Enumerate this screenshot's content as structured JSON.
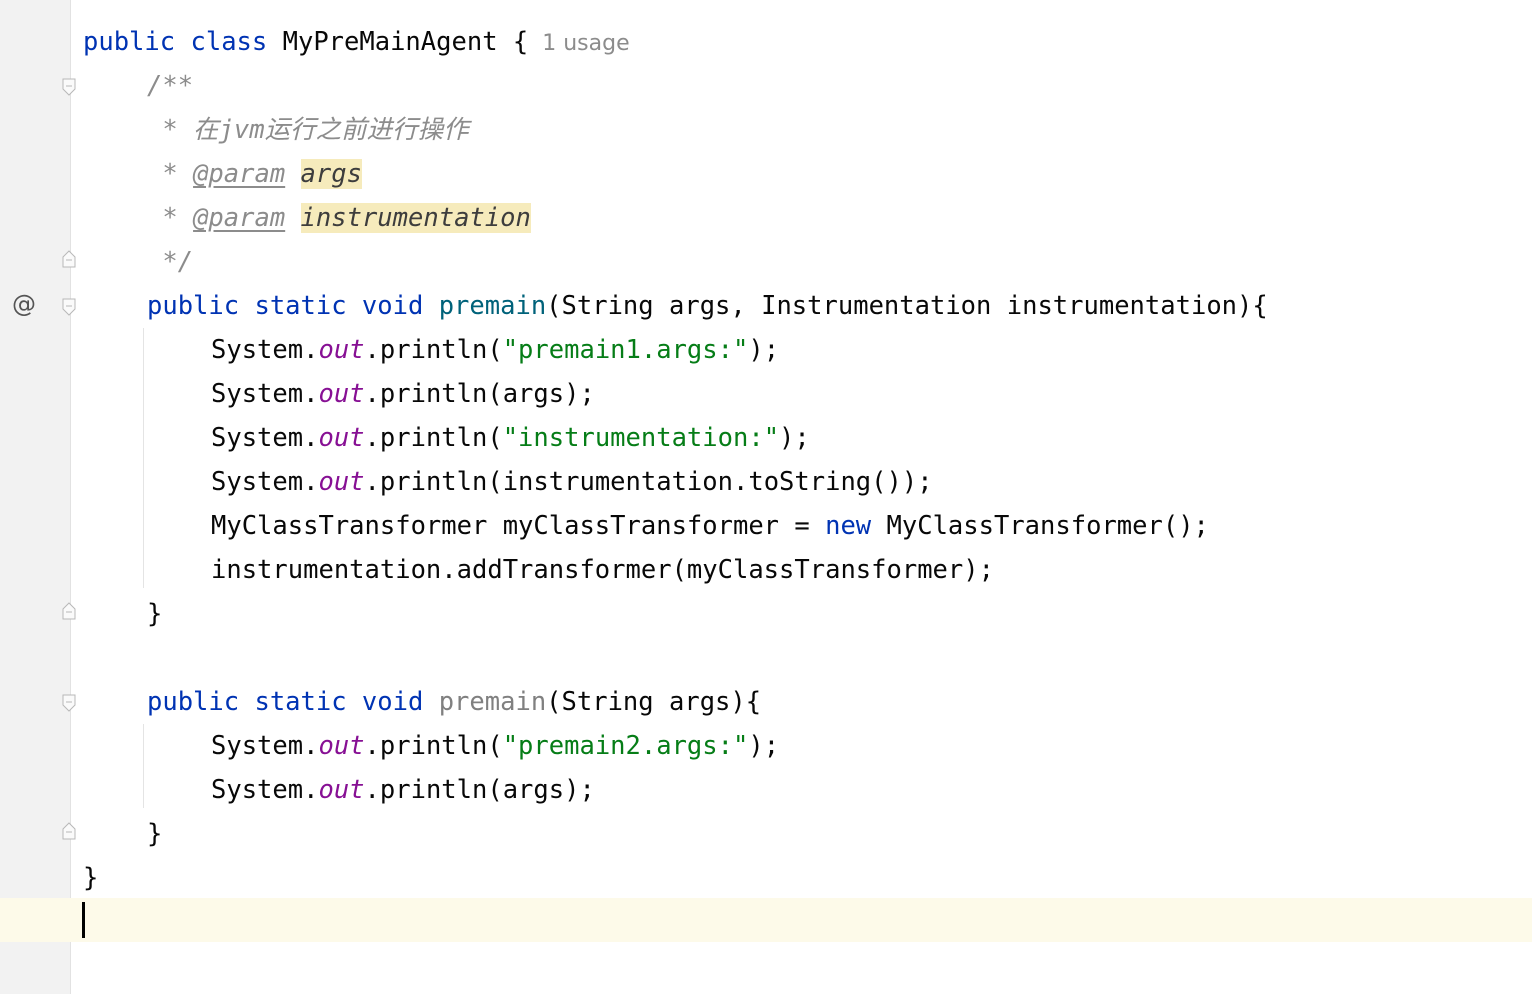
{
  "editor": {
    "inlay_hint": "1 usage",
    "gutter_icon_symbol": "@",
    "gutter_icon": "override-annotation-icon",
    "lines": {
      "l1_kw1": "public",
      "l1_kw2": "class",
      "l1_name": "MyPreMainAgent {",
      "l2": "/**",
      "l3": " * 在jvm运行之前进行操作",
      "l4_star": " * ",
      "l4_tag": "@param",
      "l4_param": "args",
      "l5_star": " * ",
      "l5_tag": "@param",
      "l5_param": "instrumentation",
      "l6": " */",
      "l7_kw": "public static void",
      "l7_fn": "premain",
      "l7_rest": "(String args, Instrumentation instrumentation){",
      "l8_a": "System.",
      "l8_out": "out",
      "l8_b": ".println(",
      "l8_str": "\"premain1.args:\"",
      "l8_c": ");",
      "l9_a": "System.",
      "l9_out": "out",
      "l9_b": ".println(args);",
      "l10_a": "System.",
      "l10_out": "out",
      "l10_b": ".println(",
      "l10_str": "\"instrumentation:\"",
      "l10_c": ");",
      "l11_a": "System.",
      "l11_out": "out",
      "l11_b": ".println(instrumentation.toString());",
      "l12_a": "MyClassTransformer myClassTransformer = ",
      "l12_kw": "new",
      "l12_b": " MyClassTransformer();",
      "l13": "instrumentation.addTransformer(myClassTransformer);",
      "l14": "}",
      "l16_kw": "public static void",
      "l16_fn": "premain",
      "l16_rest": "(String args){",
      "l17_a": "System.",
      "l17_out": "out",
      "l17_b": ".println(",
      "l17_str": "\"premain2.args:\"",
      "l17_c": ");",
      "l18_a": "System.",
      "l18_out": "out",
      "l18_b": ".println(args);",
      "l19": "}",
      "l20": "}"
    }
  }
}
